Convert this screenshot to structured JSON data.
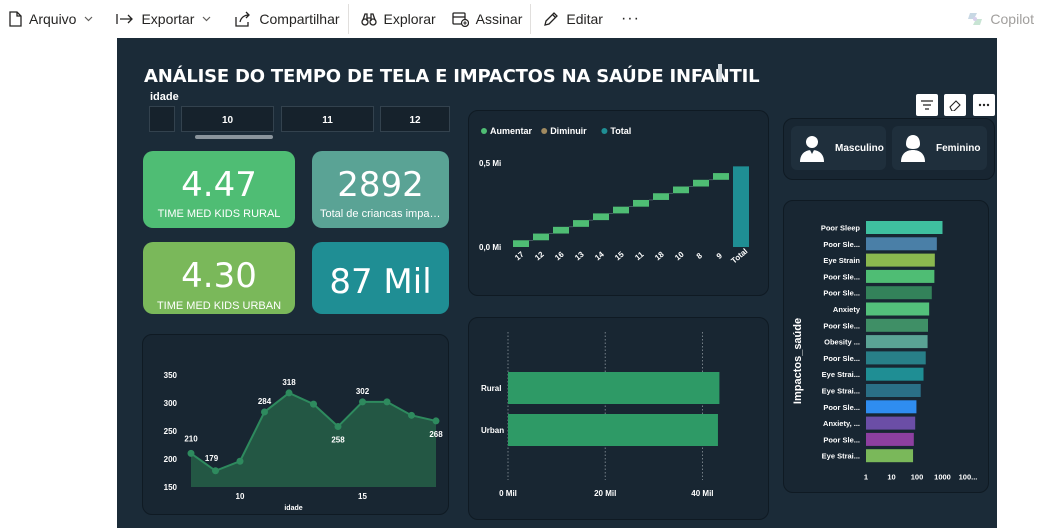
{
  "toolbar": {
    "arquivo": "Arquivo",
    "exportar": "Exportar",
    "compartilhar": "Compartilhar",
    "explorar": "Explorar",
    "assinar": "Assinar",
    "editar": "Editar",
    "more": "···",
    "copilot": "Copilot"
  },
  "report": {
    "title": "ANÁLISE DO TEMPO DE TELA E IMPACTOS NA SAÚDE INFANTIL",
    "slicer": {
      "title": "idade",
      "tiles": [
        "10",
        "11",
        "12"
      ]
    },
    "kpis": [
      {
        "value": "4.47",
        "label": "TIME MED KIDS RURAL",
        "color": "#4fbd74"
      },
      {
        "value": "2892",
        "label": "Total de criancas impac...",
        "color": "#5aa395"
      },
      {
        "value": "4.30",
        "label": "TIME MED KIDS URBAN",
        "color": "#7ab85a"
      },
      {
        "value": "87 Mil",
        "label": "",
        "color": "#1f8e94"
      }
    ],
    "gender": {
      "male": "Masculino",
      "female": "Feminino"
    }
  },
  "chart_data": [
    {
      "type": "waterfall",
      "legend": [
        "Aumentar",
        "Diminuir",
        "Total"
      ],
      "legend_position": "top-left",
      "colors": {
        "Aumentar": "#4fbd74",
        "Diminuir": "#a08a60",
        "Total": "#1f8e94"
      },
      "categories": [
        "17",
        "12",
        "16",
        "13",
        "14",
        "15",
        "11",
        "18",
        "10",
        "8",
        "9",
        "Total"
      ],
      "values": [
        0.04,
        0.04,
        0.04,
        0.04,
        0.04,
        0.04,
        0.04,
        0.04,
        0.04,
        0.04,
        0.04,
        0.48
      ],
      "ytick_labels": [
        "0,0 Mi",
        "0,5 Mi"
      ],
      "ylim": [
        0,
        0.5
      ]
    },
    {
      "type": "area",
      "x": [
        8,
        9,
        10,
        11,
        12,
        13,
        14,
        15,
        16,
        17,
        18
      ],
      "values": [
        210,
        179,
        196,
        284,
        318,
        298,
        258,
        302,
        302,
        278,
        268
      ],
      "point_labels": [
        "210",
        "179",
        "",
        "284",
        "318",
        "",
        "258",
        "302",
        "",
        "",
        "268"
      ],
      "xlabel": "idade",
      "xticks": [
        10,
        15
      ],
      "yticks": [
        150,
        200,
        250,
        300,
        350
      ],
      "ylim": [
        150,
        350
      ],
      "color": "#2e8a5e"
    },
    {
      "type": "bar",
      "orientation": "horizontal",
      "categories": [
        "Rural",
        "Urban"
      ],
      "values": [
        43.5,
        43.2
      ],
      "xtick_labels": [
        "0 Mil",
        "20 Mil",
        "40 Mil"
      ],
      "xlim": [
        0,
        50
      ],
      "color": "#2e9a66"
    },
    {
      "type": "bar",
      "orientation": "horizontal",
      "scale": "log",
      "ylabel": "Impactos_saúde",
      "categories": [
        "Poor Sleep",
        "Poor Sle...",
        "Eye Strain",
        "Poor Sle...",
        "Poor Sle...",
        "Anxiety",
        "Poor Sle...",
        "Obesity ...",
        "Poor Sle...",
        "Eye Strai...",
        "Eye Strai...",
        "Poor Sle...",
        "Anxiety, ...",
        "Poor Sle...",
        "Eye Strai..."
      ],
      "values": [
        1000,
        600,
        500,
        480,
        380,
        300,
        270,
        260,
        220,
        180,
        140,
        95,
        85,
        75,
        70
      ],
      "colors": [
        "#3fbf9f",
        "#4a7fa7",
        "#8bb84f",
        "#4fbd74",
        "#33825a",
        "#53c07b",
        "#3f8f66",
        "#5aa395",
        "#287f88",
        "#1f8e94",
        "#2a6f86",
        "#2f8df0",
        "#6b4ea6",
        "#8d3fa0",
        "#7ab85a"
      ],
      "xtick_labels": [
        "1",
        "10",
        "100",
        "1000",
        "100..."
      ]
    }
  ]
}
